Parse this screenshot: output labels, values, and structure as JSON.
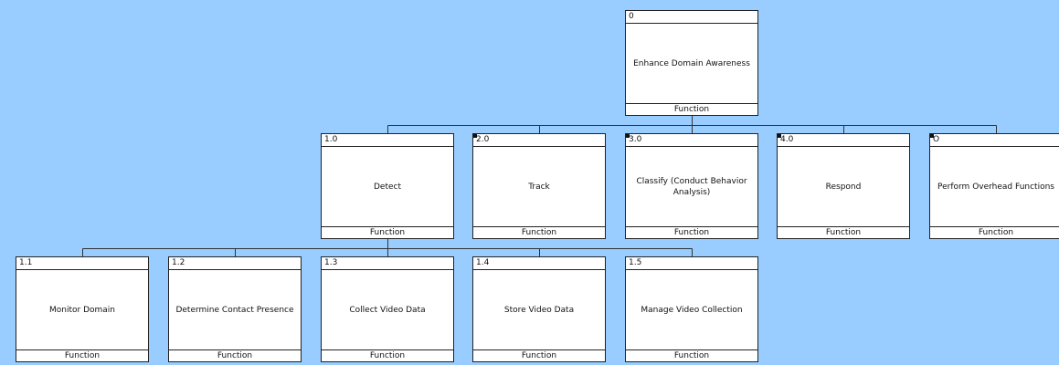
{
  "nodes": [
    {
      "id": "n0",
      "number": "0",
      "title": "Enhance Domain Awareness",
      "type": "Function",
      "marker": false
    },
    {
      "id": "n1",
      "number": "1.0",
      "title": "Detect",
      "type": "Function",
      "marker": false
    },
    {
      "id": "n2",
      "number": "2.0",
      "title": "Track",
      "type": "Function",
      "marker": true
    },
    {
      "id": "n3",
      "number": "3.0",
      "title": "Classify (Conduct Behavior Analysis)",
      "type": "Function",
      "marker": true
    },
    {
      "id": "n4",
      "number": "4.0",
      "title": "Respond",
      "type": "Function",
      "marker": true
    },
    {
      "id": "n5",
      "number": "O",
      "title": "Perform Overhead Functions",
      "type": "Function",
      "marker": true
    },
    {
      "id": "n11",
      "number": "1.1",
      "title": "Monitor Domain",
      "type": "Function",
      "marker": false
    },
    {
      "id": "n12",
      "number": "1.2",
      "title": "Determine Contact Presence",
      "type": "Function",
      "marker": false
    },
    {
      "id": "n13",
      "number": "1.3",
      "title": "Collect Video Data",
      "type": "Function",
      "marker": false
    },
    {
      "id": "n14",
      "number": "1.4",
      "title": "Store Video Data",
      "type": "Function",
      "marker": false
    },
    {
      "id": "n15",
      "number": "1.5",
      "title": "Manage Video Collection",
      "type": "Function",
      "marker": false
    }
  ],
  "edges": [
    [
      "n0",
      "n1"
    ],
    [
      "n0",
      "n2"
    ],
    [
      "n0",
      "n3"
    ],
    [
      "n0",
      "n4"
    ],
    [
      "n0",
      "n5"
    ],
    [
      "n1",
      "n11"
    ],
    [
      "n1",
      "n12"
    ],
    [
      "n1",
      "n13"
    ],
    [
      "n1",
      "n14"
    ],
    [
      "n1",
      "n15"
    ]
  ]
}
